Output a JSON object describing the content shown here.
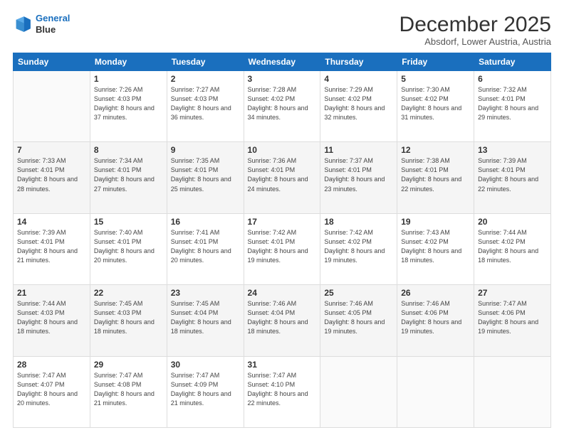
{
  "logo": {
    "line1": "General",
    "line2": "Blue"
  },
  "header": {
    "title": "December 2025",
    "subtitle": "Absdorf, Lower Austria, Austria"
  },
  "days_of_week": [
    "Sunday",
    "Monday",
    "Tuesday",
    "Wednesday",
    "Thursday",
    "Friday",
    "Saturday"
  ],
  "weeks": [
    [
      {
        "day": "",
        "info": ""
      },
      {
        "day": "1",
        "info": "Sunrise: 7:26 AM\nSunset: 4:03 PM\nDaylight: 8 hours\nand 37 minutes."
      },
      {
        "day": "2",
        "info": "Sunrise: 7:27 AM\nSunset: 4:03 PM\nDaylight: 8 hours\nand 36 minutes."
      },
      {
        "day": "3",
        "info": "Sunrise: 7:28 AM\nSunset: 4:02 PM\nDaylight: 8 hours\nand 34 minutes."
      },
      {
        "day": "4",
        "info": "Sunrise: 7:29 AM\nSunset: 4:02 PM\nDaylight: 8 hours\nand 32 minutes."
      },
      {
        "day": "5",
        "info": "Sunrise: 7:30 AM\nSunset: 4:02 PM\nDaylight: 8 hours\nand 31 minutes."
      },
      {
        "day": "6",
        "info": "Sunrise: 7:32 AM\nSunset: 4:01 PM\nDaylight: 8 hours\nand 29 minutes."
      }
    ],
    [
      {
        "day": "7",
        "info": "Sunrise: 7:33 AM\nSunset: 4:01 PM\nDaylight: 8 hours\nand 28 minutes."
      },
      {
        "day": "8",
        "info": "Sunrise: 7:34 AM\nSunset: 4:01 PM\nDaylight: 8 hours\nand 27 minutes."
      },
      {
        "day": "9",
        "info": "Sunrise: 7:35 AM\nSunset: 4:01 PM\nDaylight: 8 hours\nand 25 minutes."
      },
      {
        "day": "10",
        "info": "Sunrise: 7:36 AM\nSunset: 4:01 PM\nDaylight: 8 hours\nand 24 minutes."
      },
      {
        "day": "11",
        "info": "Sunrise: 7:37 AM\nSunset: 4:01 PM\nDaylight: 8 hours\nand 23 minutes."
      },
      {
        "day": "12",
        "info": "Sunrise: 7:38 AM\nSunset: 4:01 PM\nDaylight: 8 hours\nand 22 minutes."
      },
      {
        "day": "13",
        "info": "Sunrise: 7:39 AM\nSunset: 4:01 PM\nDaylight: 8 hours\nand 22 minutes."
      }
    ],
    [
      {
        "day": "14",
        "info": "Sunrise: 7:39 AM\nSunset: 4:01 PM\nDaylight: 8 hours\nand 21 minutes."
      },
      {
        "day": "15",
        "info": "Sunrise: 7:40 AM\nSunset: 4:01 PM\nDaylight: 8 hours\nand 20 minutes."
      },
      {
        "day": "16",
        "info": "Sunrise: 7:41 AM\nSunset: 4:01 PM\nDaylight: 8 hours\nand 20 minutes."
      },
      {
        "day": "17",
        "info": "Sunrise: 7:42 AM\nSunset: 4:01 PM\nDaylight: 8 hours\nand 19 minutes."
      },
      {
        "day": "18",
        "info": "Sunrise: 7:42 AM\nSunset: 4:02 PM\nDaylight: 8 hours\nand 19 minutes."
      },
      {
        "day": "19",
        "info": "Sunrise: 7:43 AM\nSunset: 4:02 PM\nDaylight: 8 hours\nand 18 minutes."
      },
      {
        "day": "20",
        "info": "Sunrise: 7:44 AM\nSunset: 4:02 PM\nDaylight: 8 hours\nand 18 minutes."
      }
    ],
    [
      {
        "day": "21",
        "info": "Sunrise: 7:44 AM\nSunset: 4:03 PM\nDaylight: 8 hours\nand 18 minutes."
      },
      {
        "day": "22",
        "info": "Sunrise: 7:45 AM\nSunset: 4:03 PM\nDaylight: 8 hours\nand 18 minutes."
      },
      {
        "day": "23",
        "info": "Sunrise: 7:45 AM\nSunset: 4:04 PM\nDaylight: 8 hours\nand 18 minutes."
      },
      {
        "day": "24",
        "info": "Sunrise: 7:46 AM\nSunset: 4:04 PM\nDaylight: 8 hours\nand 18 minutes."
      },
      {
        "day": "25",
        "info": "Sunrise: 7:46 AM\nSunset: 4:05 PM\nDaylight: 8 hours\nand 19 minutes."
      },
      {
        "day": "26",
        "info": "Sunrise: 7:46 AM\nSunset: 4:06 PM\nDaylight: 8 hours\nand 19 minutes."
      },
      {
        "day": "27",
        "info": "Sunrise: 7:47 AM\nSunset: 4:06 PM\nDaylight: 8 hours\nand 19 minutes."
      }
    ],
    [
      {
        "day": "28",
        "info": "Sunrise: 7:47 AM\nSunset: 4:07 PM\nDaylight: 8 hours\nand 20 minutes."
      },
      {
        "day": "29",
        "info": "Sunrise: 7:47 AM\nSunset: 4:08 PM\nDaylight: 8 hours\nand 21 minutes."
      },
      {
        "day": "30",
        "info": "Sunrise: 7:47 AM\nSunset: 4:09 PM\nDaylight: 8 hours\nand 21 minutes."
      },
      {
        "day": "31",
        "info": "Sunrise: 7:47 AM\nSunset: 4:10 PM\nDaylight: 8 hours\nand 22 minutes."
      },
      {
        "day": "",
        "info": ""
      },
      {
        "day": "",
        "info": ""
      },
      {
        "day": "",
        "info": ""
      }
    ]
  ]
}
